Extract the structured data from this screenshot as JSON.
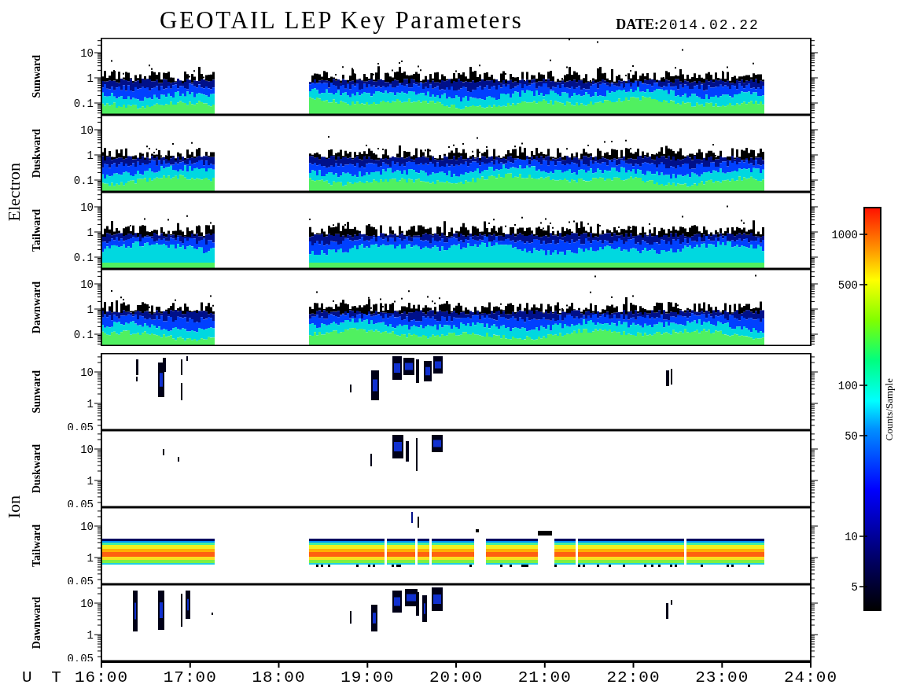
{
  "title": "GEOTAIL LEP Key Parameters",
  "date_label": "DATE:",
  "date": "2014.02.22",
  "species": [
    {
      "name": "Electron",
      "kind": "electron",
      "panels": [
        {
          "direction": "Sunward",
          "y_ticks": [
            "10",
            "1",
            "0.1"
          ]
        },
        {
          "direction": "Duskward",
          "y_ticks": [
            "10",
            "1",
            "0.1"
          ]
        },
        {
          "direction": "Tailward",
          "y_ticks": [
            "10",
            "1",
            "0.1"
          ]
        },
        {
          "direction": "Dawnward",
          "y_ticks": [
            "10",
            "1",
            "0.1"
          ]
        }
      ]
    },
    {
      "name": "Ion",
      "kind": "ion",
      "panels": [
        {
          "direction": "Sunward",
          "y_ticks": [
            "10",
            "1",
            "0.05"
          ]
        },
        {
          "direction": "Duskward",
          "y_ticks": [
            "10",
            "1",
            "0.05"
          ]
        },
        {
          "direction": "Tailward",
          "y_ticks": [
            "10",
            "1",
            "0.05"
          ]
        },
        {
          "direction": "Dawnward",
          "y_ticks": [
            "10",
            "1",
            "0.05"
          ]
        }
      ]
    }
  ],
  "x_axis": {
    "label": "U T",
    "ticks": [
      "16:00",
      "17:00",
      "18:00",
      "19:00",
      "20:00",
      "21:00",
      "22:00",
      "23:00",
      "24:00"
    ]
  },
  "colorbar": {
    "label": "Counts/Sample",
    "ticks": [
      "1000",
      "500",
      "100",
      "50",
      "10",
      "5"
    ]
  }
}
